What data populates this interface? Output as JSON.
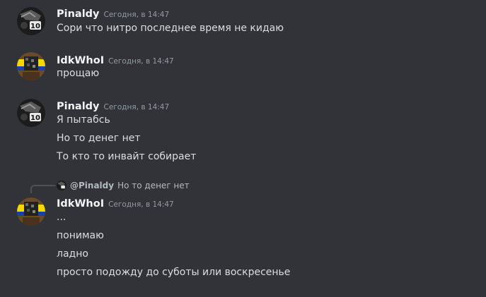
{
  "messages": [
    {
      "username": "Pinaldy",
      "timestamp": "Сегодня, в 14:47",
      "avatar": "pinaldy-avatar",
      "lines": [
        "Сори что нитро последнее время не кидаю"
      ]
    },
    {
      "username": "IdkWhoI",
      "timestamp": "Сегодня, в 14:47",
      "avatar": "idkwhoi-avatar",
      "lines": [
        "прощаю"
      ]
    },
    {
      "username": "Pinaldy",
      "timestamp": "Сегодня, в 14:47",
      "avatar": "pinaldy-avatar",
      "lines": [
        "Я пытабсь",
        "Но то денег нет",
        "То кто то инвайт собирает"
      ]
    },
    {
      "reply": {
        "username": "@Pinaldy",
        "text": "Но то денег нет"
      },
      "username": "IdkWhoI",
      "timestamp": "Сегодня, в 14:47",
      "avatar": "idkwhoi-avatar",
      "lines": [
        "...",
        "понимаю",
        "ладно",
        "просто подожду до суботы или воскресенье"
      ]
    }
  ],
  "colors": {
    "background": "#313338",
    "username": "#f2f3f5",
    "timestamp": "#949ba4",
    "text": "#dbdee1"
  }
}
